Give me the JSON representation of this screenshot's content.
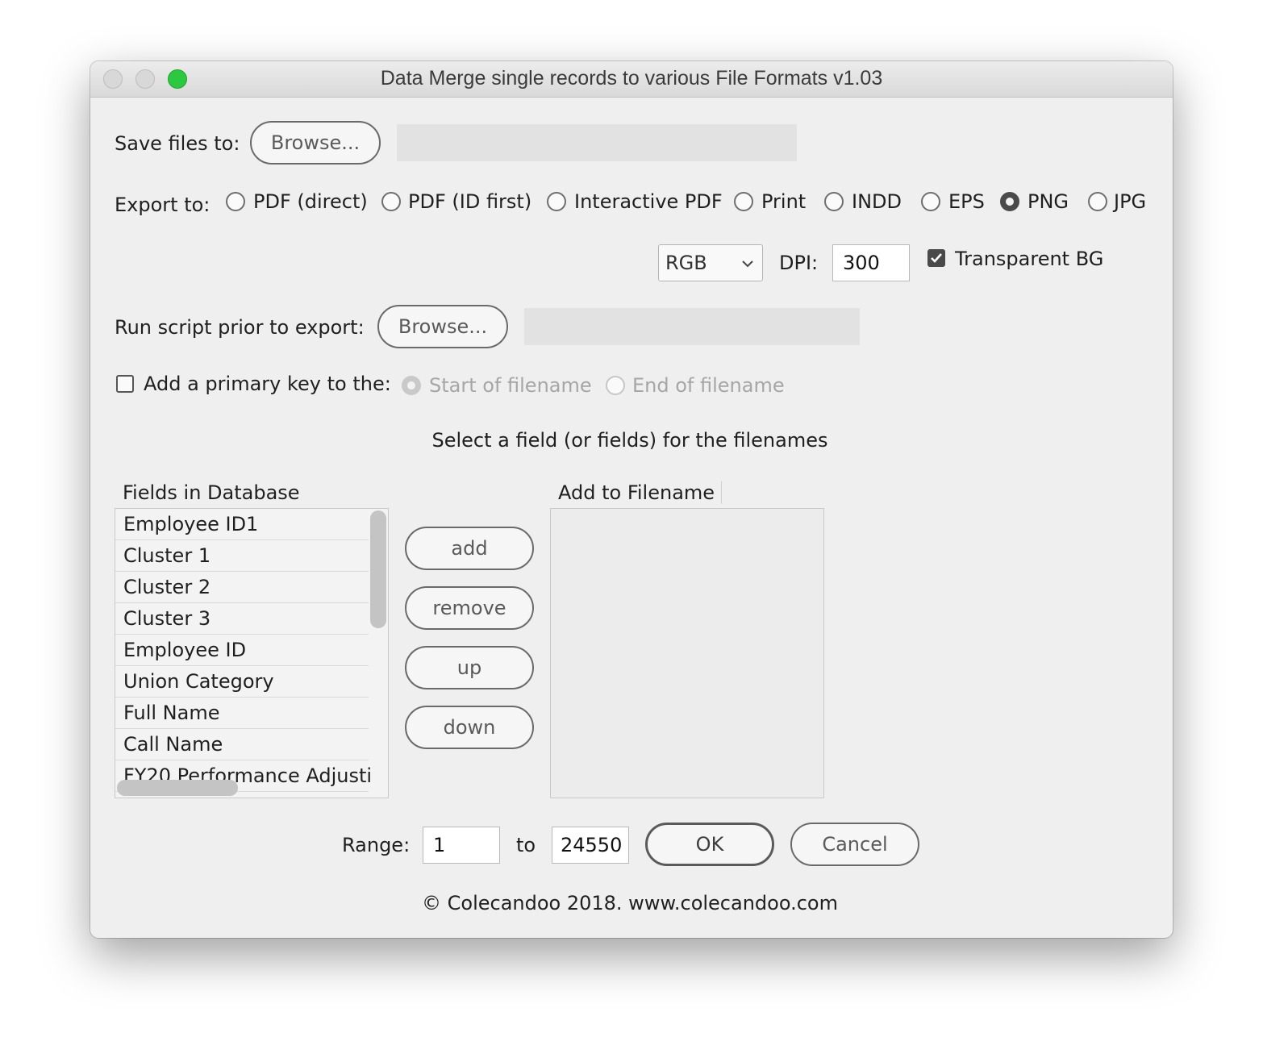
{
  "window": {
    "title": "Data Merge single records to various File Formats v1.03"
  },
  "save": {
    "label": "Save files to:",
    "browse": "Browse...",
    "path": ""
  },
  "export": {
    "label": "Export to:",
    "options": [
      "PDF (direct)",
      "PDF (ID first)",
      "Interactive PDF",
      "Print",
      "INDD",
      "EPS",
      "PNG",
      "JPG"
    ],
    "selected": "PNG"
  },
  "image_options": {
    "color_mode": "RGB",
    "dpi_label": "DPI:",
    "dpi": "300",
    "transparent_label": "Transparent BG",
    "transparent_checked": true
  },
  "script": {
    "label": "Run script prior to export:",
    "browse": "Browse...",
    "path": ""
  },
  "primary_key": {
    "label": "Add a primary key to the:",
    "checked": false,
    "start": "Start of filename",
    "end": "End of filename",
    "selected": "Start of filename"
  },
  "select_prompt": "Select a field (or fields) for the filenames",
  "fields": {
    "header": "Fields in Database",
    "items": [
      "Employee ID1",
      "Cluster 1",
      "Cluster 2",
      "Cluster 3",
      "Employee ID",
      "Union Category",
      "Full Name",
      "Call Name",
      "FY20 Performance Adjusti"
    ]
  },
  "filename": {
    "header": "Add to Filename",
    "items": []
  },
  "buttons": {
    "add": "add",
    "remove": "remove",
    "up": "up",
    "down": "down",
    "ok": "OK",
    "cancel": "Cancel"
  },
  "range": {
    "label": "Range:",
    "from": "1",
    "to_label": "to",
    "to": "24550"
  },
  "footer": "© Colecandoo 2018. www.colecandoo.com"
}
